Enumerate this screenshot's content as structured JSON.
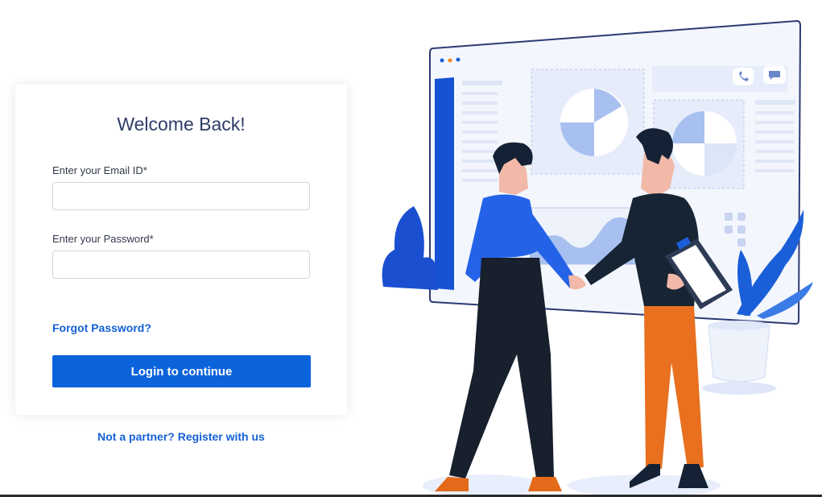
{
  "login": {
    "title": "Welcome Back!",
    "email_label": "Enter your Email ID*",
    "email_value": "",
    "password_label": "Enter your Password*",
    "password_value": "",
    "forgot_password": "Forgot Password?",
    "submit_label": "Login to continue"
  },
  "register": {
    "text": "Not a partner? Register with us"
  },
  "colors": {
    "primary": "#0b63dc",
    "title": "#2f3d68",
    "link": "#1460d8"
  },
  "illustration": {
    "icon_names": [
      "window-dots-icon",
      "phone-icon",
      "chat-icon",
      "pie-chart-icon",
      "plant-icon",
      "clipboard-icon"
    ]
  }
}
